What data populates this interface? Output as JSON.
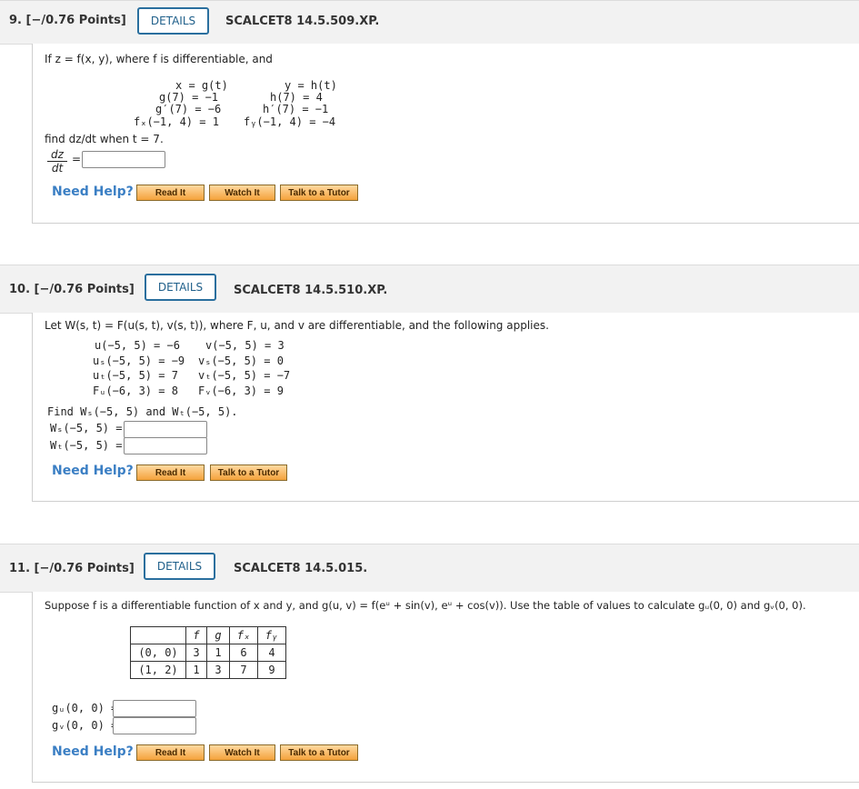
{
  "questions": [
    {
      "number": "9. [−/0.76 Points]",
      "details": "DETAILS",
      "code": "SCALCET8 14.5.509.XP.",
      "intro": "If z = f(x, y), where f is differentiable, and",
      "left_lines": [
        "x = g(t)",
        "g(7) = −1",
        "g′(7) = −6",
        "fₓ(−1, 4) = 1"
      ],
      "right_lines": [
        "y = h(t)",
        "h(7) = 4",
        "h′(7) = −1",
        "fᵧ(−1, 4) = −4"
      ],
      "find": "find dz/dt when t = 7.",
      "frac_num": "dz",
      "frac_den": "dt",
      "equals": "=",
      "help_label": "Need Help?",
      "buttons": [
        "Read It",
        "Watch It",
        "Talk to a Tutor"
      ]
    },
    {
      "number": "10. [−/0.76 Points]",
      "details": "DETAILS",
      "code": "SCALCET8 14.5.510.XP.",
      "intro": "Let W(s, t) = F(u(s, t), v(s, t)), where F, u, and v are differentiable, and the following applies.",
      "left_lines": [
        "u(−5, 5) = −6",
        "uₛ(−5, 5) = −9",
        "uₜ(−5, 5) = 7",
        "Fᵤ(−6, 3) = 8"
      ],
      "right_lines": [
        "v(−5, 5) = 3",
        "vₛ(−5, 5) = 0",
        "vₜ(−5, 5) = −7",
        "Fᵥ(−6, 3) = 9"
      ],
      "find": "Find Wₛ(−5, 5) and Wₜ(−5, 5).",
      "answers": [
        "Wₛ(−5, 5) =",
        "Wₜ(−5, 5) ="
      ],
      "help_label": "Need Help?",
      "buttons": [
        "Read It",
        "Talk to a Tutor"
      ]
    },
    {
      "number": "11. [−/0.76 Points]",
      "details": "DETAILS",
      "code": "SCALCET8 14.5.015.",
      "intro": "Suppose f is a differentiable function of x and y, and g(u, v) = f(eᵘ + sin(v), eᵘ + cos(v)).  Use the table of values to calculate  gᵤ(0, 0)  and  gᵥ(0, 0).",
      "table": {
        "header": [
          "",
          "f",
          "g",
          "fₓ",
          "fᵧ"
        ],
        "rows": [
          [
            "(0, 0)",
            "3",
            "1",
            "6",
            "4"
          ],
          [
            "(1, 2)",
            "1",
            "3",
            "7",
            "9"
          ]
        ]
      },
      "answers": [
        "gᵤ(0, 0) =",
        "gᵥ(0, 0) ="
      ],
      "help_label": "Need Help?",
      "buttons": [
        "Read It",
        "Watch It",
        "Talk to a Tutor"
      ]
    }
  ]
}
